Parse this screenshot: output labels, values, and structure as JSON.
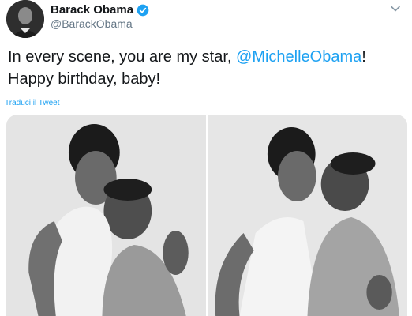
{
  "tweet": {
    "author": {
      "display_name": "Barack Obama",
      "handle": "@BarackObama",
      "verified": true,
      "verified_icon": "verified-badge-icon",
      "verified_color": "#1da1f2"
    },
    "text_main": "In every scene, you are my star, ",
    "mention": "@MichelleObama",
    "text_end": "!",
    "text_line2": "Happy birthday, baby!",
    "translate_label": "Traduci il Tweet",
    "menu_icon": "chevron-down-icon",
    "media": [
      {
        "alt": "photo-booth-portrait-1"
      },
      {
        "alt": "photo-booth-portrait-2"
      }
    ]
  },
  "colors": {
    "link": "#1da1f2",
    "text": "#14171a",
    "secondary": "#657786"
  }
}
